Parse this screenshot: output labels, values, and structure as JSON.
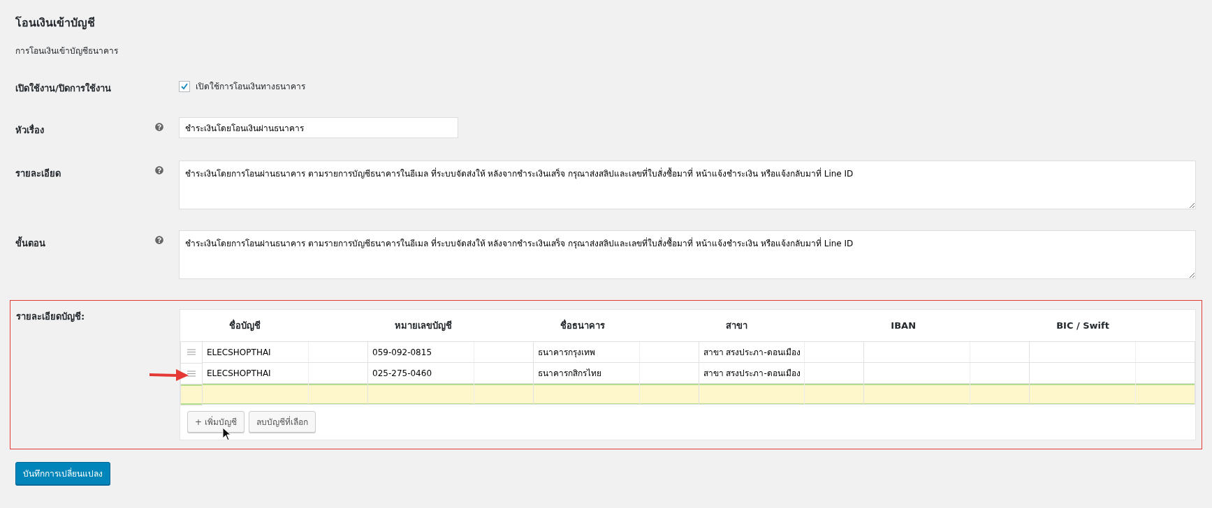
{
  "heading": "โอนเงินเข้าบัญชี",
  "description": "การโอนเงินเข้าบัญชีธนาคาร",
  "fields": [
    {
      "kind": "checkbox",
      "label": "เปิดใช้งาน/ปิดการใช้งาน",
      "checked": true,
      "text": "เปิดใช้การโอนเงินทางธนาคาร"
    },
    {
      "kind": "text",
      "label": "หัวเรื่อง",
      "value": "ชำระเงินโดยโอนเงินผ่านธนาคาร"
    },
    {
      "kind": "textarea",
      "label": "รายละเอียด",
      "value": "ชำระเงินโดยการโอนผ่านธนาคาร ตามรายการบัญชีธนาคารในอีเมล ที่ระบบจัดส่งให้ หลังจากชำระเงินเสร็จ กรุณาส่งสลิปและเลขที่ใบสั่งซื้อมาที่ หน้าแจ้งชำระเงิน หรือแจ้งกลับมาที่ Line ID"
    },
    {
      "kind": "textarea",
      "label": "ขั้นตอน",
      "value": "ชำระเงินโดยการโอนผ่านธนาคาร ตามรายการบัญชีธนาคารในอีเมล ที่ระบบจัดส่งให้ หลังจากชำระเงินเสร็จ กรุณาส่งสลิปและเลขที่ใบสั่งซื้อมาที่ หน้าแจ้งชำระเงิน หรือแจ้งกลับมาที่ Line ID"
    }
  ],
  "accounts": {
    "label": "รายละเอียดบัญชี:",
    "columns": [
      "ชื่อบัญชี",
      "หมายเลขบัญชี",
      "ชื่อธนาคาร",
      "สาขา",
      "IBAN",
      "BIC / Swift"
    ],
    "rows": [
      {
        "selected": false,
        "cells": [
          "ELECSHOPTHAI",
          "059-092-0815",
          "ธนาคารกรุงเทพ",
          "สาขา สรงประภา-ดอนเมือง",
          "",
          ""
        ]
      },
      {
        "selected": false,
        "cells": [
          "ELECSHOPTHAI",
          "025-275-0460",
          "ธนาคารกสิกรไทย",
          "สาขา สรงประภา-ดอนเมือง",
          "",
          ""
        ]
      },
      {
        "selected": true,
        "cells": [
          "",
          "",
          "",
          "",
          "",
          ""
        ]
      }
    ],
    "buttons": [
      "+ เพิ่มบัญชี",
      "ลบบัญชีที่เลือก"
    ]
  },
  "save_button": "บันทึกการเปลี่ยนแปลง"
}
